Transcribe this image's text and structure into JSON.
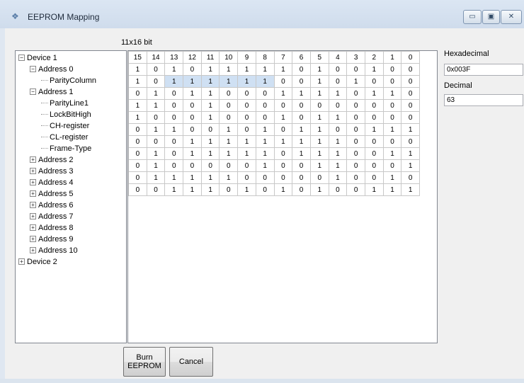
{
  "window": {
    "title": "EEPROM Mapping",
    "minimize_glyph": "▭",
    "maximize_glyph": "▣",
    "close_glyph": "✕"
  },
  "grid": {
    "caption": "11x16 bit",
    "headers": [
      "15",
      "14",
      "13",
      "12",
      "11",
      "10",
      "9",
      "8",
      "7",
      "6",
      "5",
      "4",
      "3",
      "2",
      "1",
      "0"
    ],
    "rows": [
      [
        "1",
        "0",
        "1",
        "0",
        "1",
        "1",
        "1",
        "1",
        "1",
        "0",
        "1",
        "0",
        "0",
        "1",
        "0",
        "0"
      ],
      [
        "1",
        "0",
        "1",
        "1",
        "1",
        "1",
        "1",
        "1",
        "0",
        "0",
        "1",
        "0",
        "1",
        "0",
        "0",
        "0"
      ],
      [
        "0",
        "1",
        "0",
        "1",
        "1",
        "0",
        "0",
        "0",
        "1",
        "1",
        "1",
        "1",
        "0",
        "1",
        "1",
        "0"
      ],
      [
        "1",
        "1",
        "0",
        "0",
        "1",
        "0",
        "0",
        "0",
        "0",
        "0",
        "0",
        "0",
        "0",
        "0",
        "0",
        "0"
      ],
      [
        "1",
        "0",
        "0",
        "0",
        "1",
        "0",
        "0",
        "0",
        "1",
        "0",
        "1",
        "1",
        "0",
        "0",
        "0",
        "0"
      ],
      [
        "0",
        "1",
        "1",
        "0",
        "0",
        "1",
        "0",
        "1",
        "0",
        "1",
        "1",
        "0",
        "0",
        "1",
        "1",
        "1"
      ],
      [
        "0",
        "0",
        "0",
        "1",
        "1",
        "1",
        "1",
        "1",
        "1",
        "1",
        "1",
        "1",
        "0",
        "0",
        "0",
        "0"
      ],
      [
        "0",
        "1",
        "0",
        "1",
        "1",
        "1",
        "1",
        "1",
        "0",
        "1",
        "1",
        "1",
        "0",
        "0",
        "1",
        "1"
      ],
      [
        "0",
        "1",
        "0",
        "0",
        "0",
        "0",
        "0",
        "1",
        "0",
        "0",
        "1",
        "1",
        "0",
        "0",
        "0",
        "1"
      ],
      [
        "0",
        "1",
        "1",
        "1",
        "1",
        "1",
        "0",
        "0",
        "0",
        "0",
        "0",
        "1",
        "0",
        "0",
        "1",
        "0"
      ],
      [
        "0",
        "0",
        "1",
        "1",
        "1",
        "0",
        "1",
        "0",
        "1",
        "0",
        "1",
        "0",
        "0",
        "1",
        "1",
        "1"
      ]
    ],
    "selected_row": 1,
    "selected_cols": [
      2,
      3,
      4,
      5,
      6,
      7
    ]
  },
  "tree": {
    "nodes": [
      {
        "label": "Device 1",
        "expander": "−"
      },
      {
        "label": "Address 0",
        "expander": "−"
      },
      {
        "label": "ParityColumn",
        "expander": ""
      },
      {
        "label": "Address 1",
        "expander": "−"
      },
      {
        "label": "ParityLine1",
        "expander": ""
      },
      {
        "label": "LockBitHigh",
        "expander": ""
      },
      {
        "label": "CH-register",
        "expander": ""
      },
      {
        "label": "CL-register",
        "expander": ""
      },
      {
        "label": "Frame-Type",
        "expander": ""
      },
      {
        "label": "Address 2",
        "expander": "+"
      },
      {
        "label": "Address 3",
        "expander": "+"
      },
      {
        "label": "Address 4",
        "expander": "+"
      },
      {
        "label": "Address 5",
        "expander": "+"
      },
      {
        "label": "Address 6",
        "expander": "+"
      },
      {
        "label": "Address 7",
        "expander": "+"
      },
      {
        "label": "Address 8",
        "expander": "+"
      },
      {
        "label": "Address 9",
        "expander": "+"
      },
      {
        "label": "Address 10",
        "expander": "+"
      },
      {
        "label": "Device 2",
        "expander": "+"
      }
    ]
  },
  "side": {
    "hex_label": "Hexadecimal",
    "hex_value": "0x003F",
    "dec_label": "Decimal",
    "dec_value": "63"
  },
  "buttons": {
    "burn_label_line1": "Burn",
    "burn_label_line2": "EEPROM",
    "cancel_label": "Cancel"
  }
}
